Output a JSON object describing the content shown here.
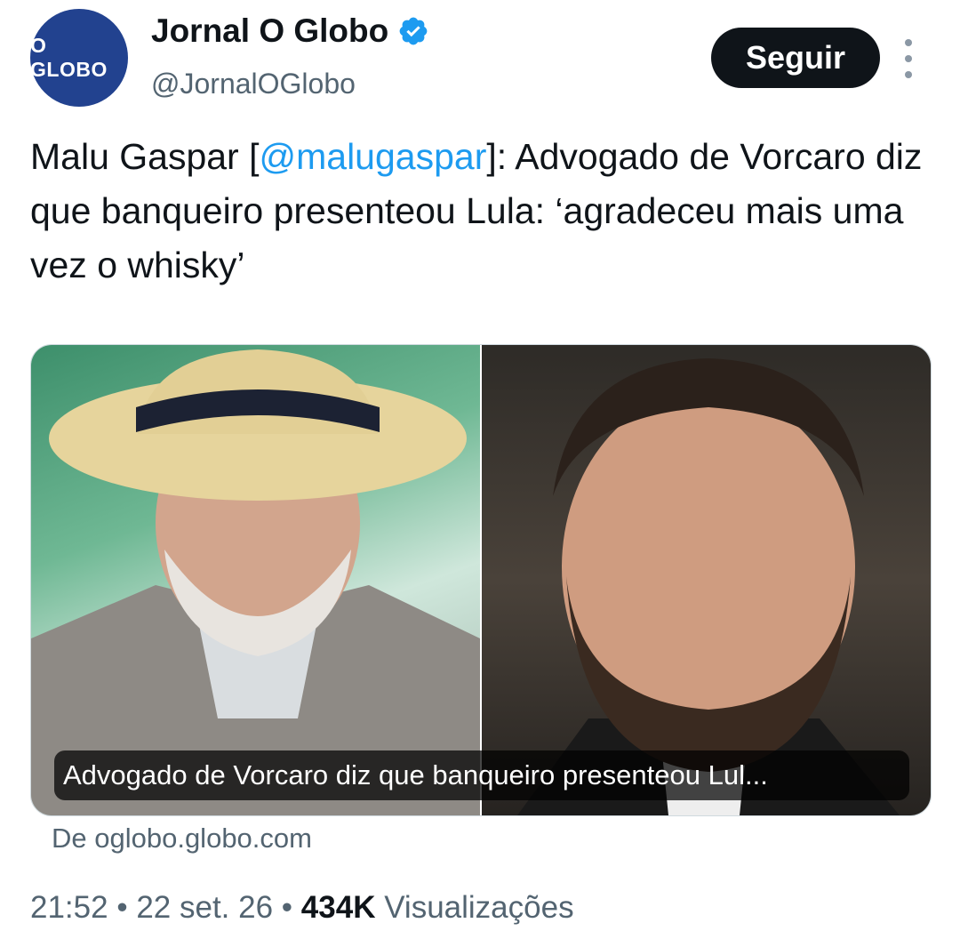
{
  "author": {
    "avatar_text": "O GLOBO",
    "display_name": "Jornal O Globo",
    "handle": "@JornalOGlobo",
    "verified_icon": "verified-badge-icon",
    "colors": {
      "avatar_bg": "#22428f",
      "verified": "#1d9bf0"
    }
  },
  "actions": {
    "follow_label": "Seguir",
    "more_icon": "more-vertical-icon"
  },
  "tweet": {
    "prefix": "Malu Gaspar [",
    "mention": "@malugaspar",
    "suffix": "]: Advogado de Vorcaro diz que banqueiro presenteou Lula: ‘agradeceu mais uma vez o whisky’"
  },
  "card": {
    "caption": "Advogado de Vorcaro diz que banqueiro presenteou Lul...",
    "source": "De oglobo.globo.com"
  },
  "meta": {
    "time": "21:52",
    "separator": "•",
    "date": "22 set. 26",
    "views_count": "434K",
    "views_label": "Visualizações"
  }
}
